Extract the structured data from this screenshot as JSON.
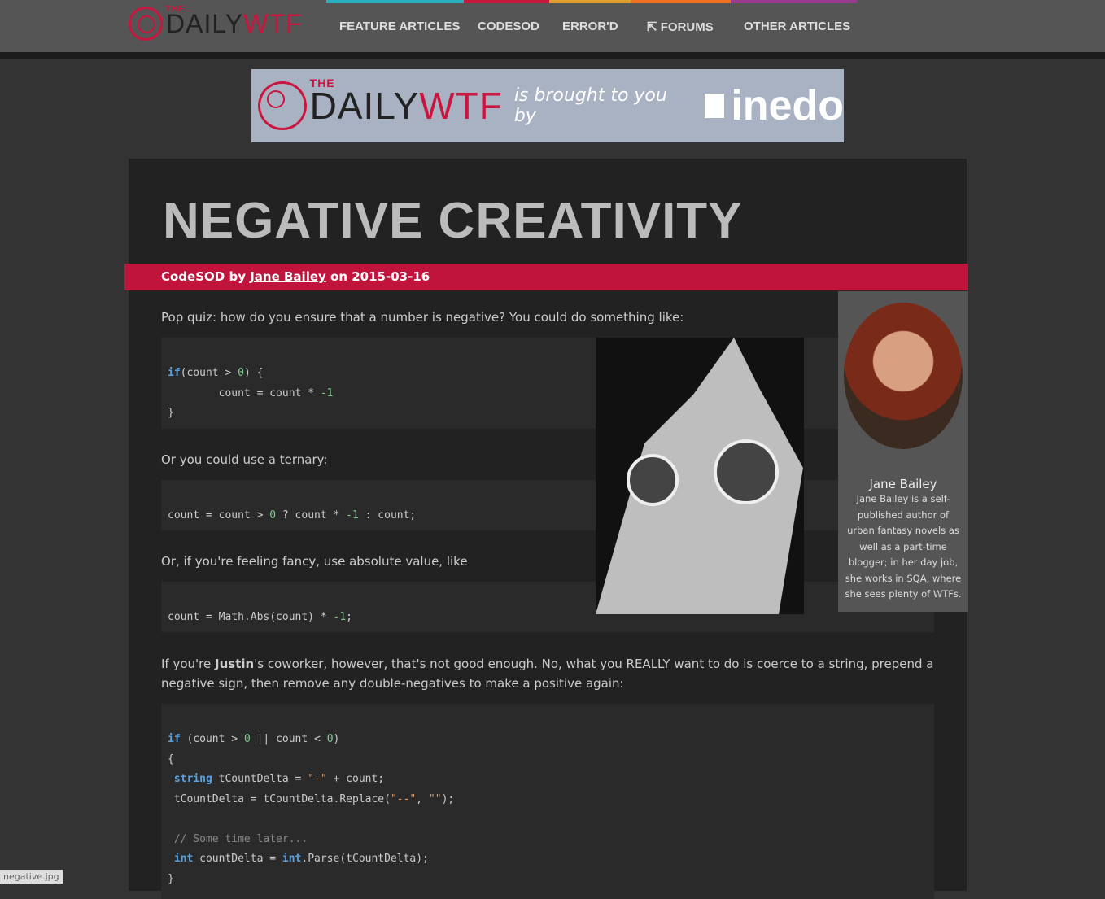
{
  "header": {
    "logo_the": "THE",
    "logo_daily": "DAILY",
    "logo_wtf": "WTF",
    "nav": [
      "FEATURE ARTICLES",
      "CODESOD",
      "ERROR'D",
      "FORUMS",
      "OTHER ARTICLES"
    ],
    "accent_colors": [
      "#2ab0c0",
      "#c8163e",
      "#e0a030",
      "#f07020",
      "#9a3a90"
    ]
  },
  "banner": {
    "the": "THE",
    "daily": "DAILY",
    "wtf": "WTF",
    "tagline": "is brought to you by",
    "sponsor": "inedo"
  },
  "article": {
    "title": "NEGATIVE CREATIVITY",
    "category": "CodeSOD",
    "by": "by",
    "author": "Jane Bailey",
    "on": "on",
    "date": "2015-03-16",
    "p1": "Pop quiz: how do you ensure that a number is negative? You could do something like:",
    "p2": "Or you could use a ternary:",
    "p3": "Or, if you're feeling fancy, use absolute value, like",
    "p4_pre": "If you're ",
    "p4_bold": "Justin",
    "p4_post": "'s coworker, however, that's not good enough. No, what you REALLY want to do is coerce to a string, prepend a negative sign, then remove any double-negatives to make a positive again:",
    "code": [
      [
        [
          [
            "kw",
            "if"
          ],
          [
            "",
            "(count > "
          ],
          [
            "num",
            "0"
          ],
          [
            "",
            ") {"
          ]
        ],
        [
          [
            "",
            "        count = count * "
          ],
          [
            "num",
            "-1"
          ]
        ],
        [
          [
            "",
            "}"
          ]
        ]
      ],
      [
        [
          [
            "",
            "count = count > "
          ],
          [
            "num",
            "0"
          ],
          [
            "",
            " ? count * "
          ],
          [
            "num",
            "-1"
          ],
          [
            "",
            " : count;"
          ]
        ]
      ],
      [
        [
          [
            "",
            "count = Math.Abs(count) * "
          ],
          [
            "num",
            "-1"
          ],
          [
            "",
            ";"
          ]
        ]
      ],
      [
        [
          [
            "kw",
            "if"
          ],
          [
            "",
            " (count > "
          ],
          [
            "num",
            "0"
          ],
          [
            "",
            " || count < "
          ],
          [
            "num",
            "0"
          ],
          [
            "",
            ")"
          ]
        ],
        [
          [
            "",
            "{"
          ]
        ],
        [
          [
            "kw",
            " string"
          ],
          [
            "",
            " tCountDelta = "
          ],
          [
            "str",
            "\"-\""
          ],
          [
            "",
            " + count;"
          ]
        ],
        [
          [
            "",
            " tCountDelta = tCountDelta.Replace("
          ],
          [
            "str",
            "\"--\""
          ],
          [
            "",
            ", "
          ],
          [
            "str",
            "\"\""
          ],
          [
            "",
            ");"
          ]
        ],
        [
          [
            "",
            ""
          ]
        ],
        [
          [
            "cm",
            " // Some time later..."
          ]
        ],
        [
          [
            "kw",
            " int"
          ],
          [
            "",
            " countDelta = "
          ],
          [
            "kw",
            "int"
          ],
          [
            "",
            ".Parse(tCountDelta);"
          ]
        ],
        [
          [
            "",
            "}"
          ]
        ]
      ]
    ]
  },
  "sidebar": {
    "name": "Jane Bailey",
    "bio": "Jane Bailey is a self-published author of urban fantasy novels as well as a part-time blogger; in her day job, she works in SQA, where she sees plenty of WTFs."
  },
  "status": {
    "file": "negative.jpg"
  }
}
